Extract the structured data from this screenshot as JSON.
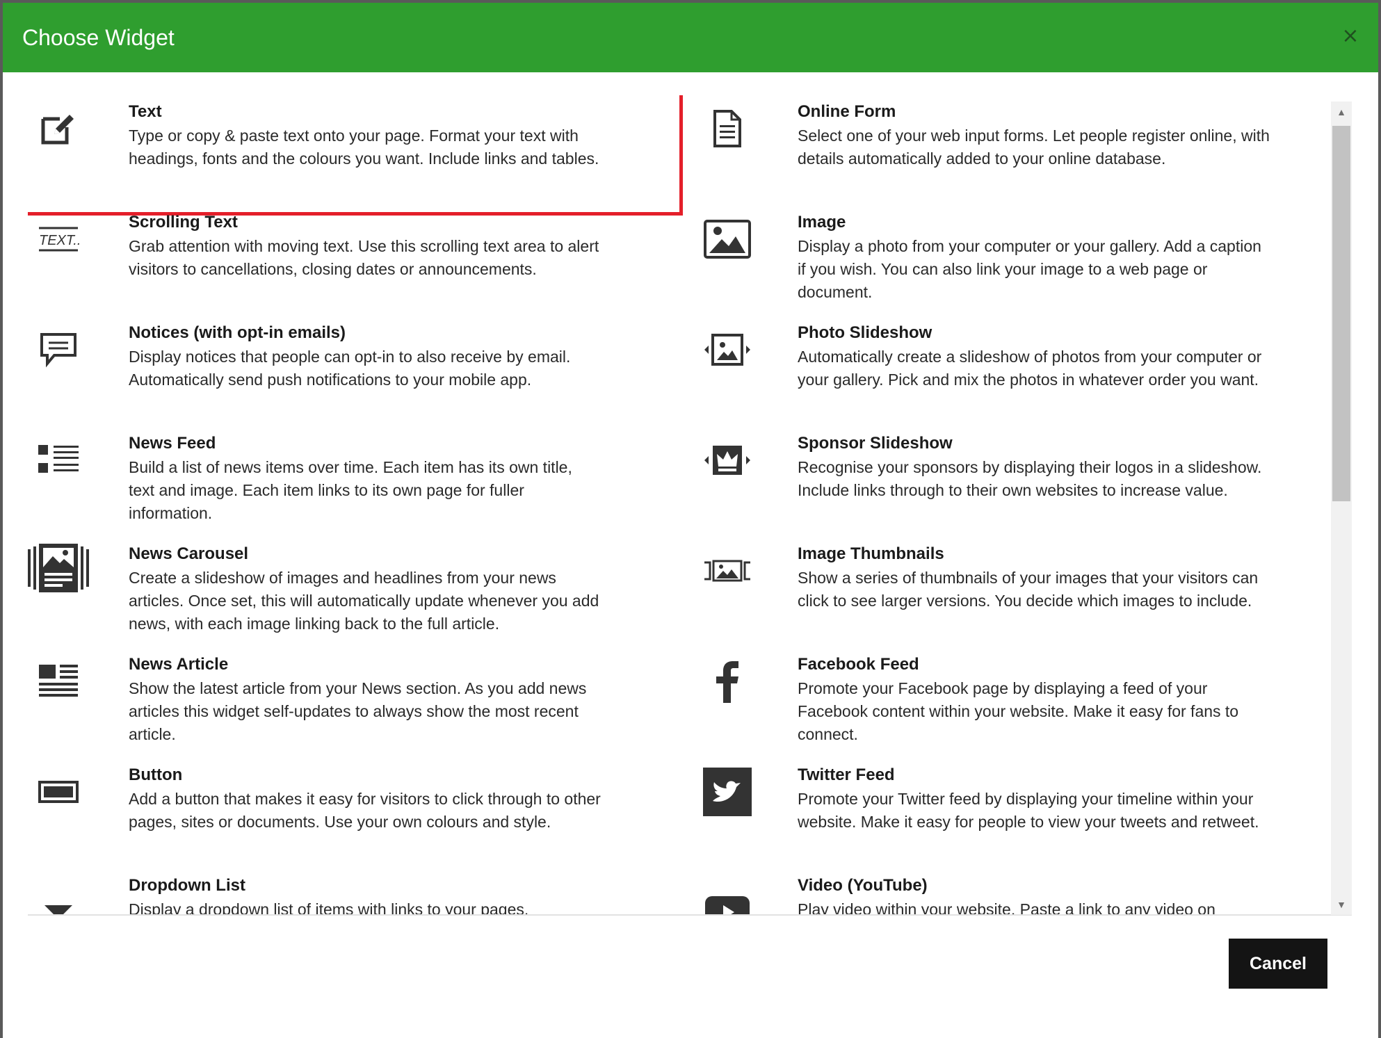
{
  "dialog": {
    "title": "Choose Widget",
    "close_icon": "×",
    "cancel_label": "Cancel"
  },
  "widgets_left": [
    {
      "title": "Text",
      "icon": "edit-icon",
      "selected": true,
      "desc": "Type or copy & paste text onto your page. Format your text with headings, fonts and the colours you want. Include links and tables."
    },
    {
      "title": "Scrolling Text",
      "icon": "scrolling-text-icon",
      "icon_text": "TEXT...",
      "desc": "Grab attention with moving text. Use this scrolling text area to alert visitors to cancellations, closing dates or announcements."
    },
    {
      "title": "Notices (with opt-in emails)",
      "icon": "comment-icon",
      "desc": "Display notices that people can opt-in to also receive by email. Automatically send push notifications to your mobile app."
    },
    {
      "title": "News Feed",
      "icon": "list-icon",
      "desc": "Build a list of news items over time. Each item has its own title, text and image. Each item links to its own page for fuller information."
    },
    {
      "title": "News Carousel",
      "icon": "carousel-icon",
      "desc": "Create a slideshow of images and headlines from your news articles. Once set, this will automatically update whenever you add news, with each image linking back to the full article."
    },
    {
      "title": "News Article",
      "icon": "article-icon",
      "desc": "Show the latest article from your News section. As you add news articles this widget self-updates to always show the most recent article."
    },
    {
      "title": "Button",
      "icon": "button-icon",
      "desc": "Add a button that makes it easy for visitors to click through to other pages, sites or documents. Use your own colours and style."
    },
    {
      "title": "Dropdown List",
      "icon": "dropdown-arrow-icon",
      "desc": "Display a dropdown list of items with links to your pages."
    }
  ],
  "widgets_right": [
    {
      "title": "Online Form",
      "icon": "document-icon",
      "desc": "Select one of your web input forms. Let people register online, with details automatically added to your online database."
    },
    {
      "title": "Image",
      "icon": "image-icon",
      "desc": "Display a photo from your computer or your gallery. Add a caption if you wish. You can also link your image to a web page or document."
    },
    {
      "title": "Photo Slideshow",
      "icon": "photo-slideshow-icon",
      "desc": "Automatically create a slideshow of photos from your computer or your gallery. Pick and mix the photos in whatever order you want."
    },
    {
      "title": "Sponsor Slideshow",
      "icon": "crown-slideshow-icon",
      "desc": "Recognise your sponsors by displaying their logos in a slideshow. Include links through to their own websites to increase value."
    },
    {
      "title": "Image Thumbnails",
      "icon": "thumbnails-icon",
      "desc": "Show a series of thumbnails of your images that your visitors can click to see larger versions. You decide which images to include."
    },
    {
      "title": "Facebook Feed",
      "icon": "facebook-icon",
      "desc": "Promote your Facebook page by displaying a feed of your Facebook content within your website. Make it easy for fans to connect."
    },
    {
      "title": "Twitter Feed",
      "icon": "twitter-icon",
      "desc": "Promote your Twitter feed by displaying your timeline within your website. Make it easy for people to view your tweets and retweet."
    },
    {
      "title": "Video (YouTube)",
      "icon": "youtube-icon",
      "desc": "Play video within your website. Paste a link to any video on"
    }
  ],
  "colors": {
    "header": "#2f9e2f",
    "selection": "#e41f2a",
    "cancel_bg": "#141414"
  }
}
